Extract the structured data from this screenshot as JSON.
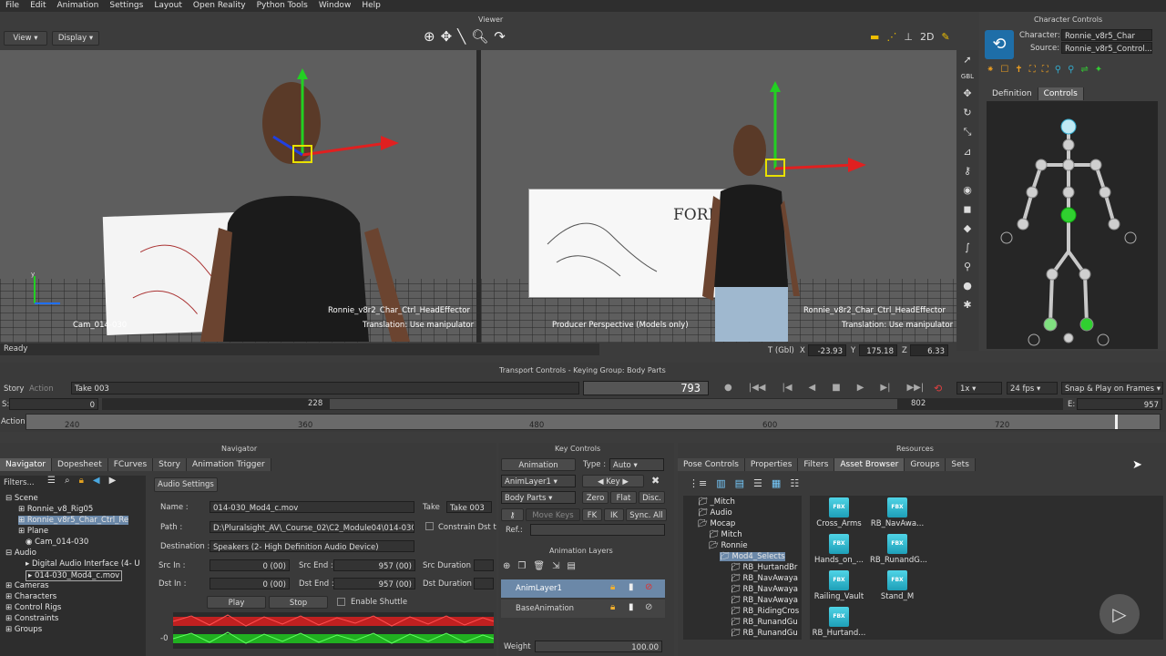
{
  "menu": [
    "File",
    "Edit",
    "Animation",
    "Settings",
    "Layout",
    "Open Reality",
    "Python Tools",
    "Window",
    "Help"
  ],
  "viewer": {
    "title": "Viewer",
    "view_btn": "View",
    "display_btn": "Display",
    "left_cam": "Cam_014-030",
    "left_effector": "Ronnie_v8r2_Char_Ctrl_HeadEffector",
    "left_translation": "Translation: Use manipulator",
    "right_cam": "Producer Perspective (Models only)",
    "right_effector": "Ronnie_v8r2_Char_Ctrl_HeadEffector",
    "right_translation": "Translation: Use manipulator",
    "status": "Ready",
    "coord_label": "T (Gbl)",
    "x": "-23.93",
    "y": "175.18",
    "z": "6.33",
    "board_text": "FORE"
  },
  "character_controls": {
    "title": "Character Controls",
    "character_label": "Character:",
    "character_value": "Ronnie_v8r5_Char",
    "source_label": "Source:",
    "source_value": "Ronnie_v8r5_Control...",
    "tab_definition": "Definition",
    "tab_controls": "Controls"
  },
  "transport": {
    "title": "Transport Controls  -  Keying Group: Body Parts",
    "story": "Story",
    "action": "Action",
    "take": "Take 003",
    "frame": "793",
    "speed": "1x",
    "fps": "24 fps",
    "snap": "Snap & Play on Frames",
    "s_label": "S:",
    "s_val": "0",
    "slider_left": "228",
    "slider_right": "802",
    "e_label": "E:",
    "e_val": "957",
    "action_label": "Action",
    "ticks": [
      "240",
      "360",
      "480",
      "600",
      "720"
    ]
  },
  "navigator": {
    "title": "Navigator",
    "tabs": [
      "Navigator",
      "Dopesheet",
      "FCurves",
      "Story",
      "Animation Trigger"
    ],
    "filters": "Filters...",
    "tree": [
      "Scene",
      "Ronnie_v8_Rig05",
      "Ronnie_v8r5_Char_Ctrl_Re",
      "Plane",
      "Cam_014-030",
      "Audio",
      "Digital Audio Interface (4- U",
      "014-030_Mod4_c.mov",
      "Cameras",
      "Characters",
      "Control Rigs",
      "Constraints",
      "Groups"
    ],
    "audio_settings": "Audio Settings",
    "name_label": "Name :",
    "name_value": "014-030_Mod4_c.mov",
    "take_label": "Take",
    "take_value": "Take 003",
    "path_label": "Path :",
    "path_value": "D:\\Pluralsight_AV\\_Course_02\\C2_Module04\\014-030_Mo",
    "constrain": "Constrain Dst t",
    "dest_label": "Destination :",
    "dest_value": "Speakers (2- High Definition Audio Device)",
    "srcin_label": "Src In :",
    "srcin_val": "0 (00)",
    "srcend_label": "Src End :",
    "srcend_val": "957 (00)",
    "srcdur_label": "Src Duration :",
    "dstin_label": "Dst In :",
    "dstin_val": "0 (00)",
    "dstend_label": "Dst End :",
    "dstend_val": "957 (00)",
    "dstdur_label": "Dst Duration :",
    "play": "Play",
    "stop": "Stop",
    "shuttle": "Enable Shuttle",
    "wave_label": "-0"
  },
  "key_controls": {
    "title": "Key Controls",
    "animation": "Animation",
    "type_label": "Type :",
    "type_value": "Auto",
    "layer": "AnimLayer1",
    "key": "Key",
    "body_parts": "Body Parts",
    "zero": "Zero",
    "flat": "Flat",
    "disc": "Disc.",
    "move_keys": "Move Keys",
    "fk": "FK",
    "ik": "IK",
    "sync": "Sync. All",
    "ref": "Ref.:",
    "layers_title": "Animation Layers",
    "layer1": "AnimLayer1",
    "base": "BaseAnimation",
    "weight": "Weight",
    "weight_val": "100.00"
  },
  "resources": {
    "title": "Resources",
    "tabs": [
      "Pose Controls",
      "Properties",
      "Filters",
      "Asset Browser",
      "Groups",
      "Sets"
    ],
    "tree": [
      "_Mitch",
      "Audio",
      "Mocap",
      "Mitch",
      "Ronnie",
      "Mod4_Selects",
      "RB_HurtandBr",
      "RB_NavAwaya",
      "RB_NavAwaya",
      "RB_NavAwaya",
      "RB_RidingCros",
      "RB_RunandGu",
      "RB_RunandGu"
    ],
    "assets": [
      "Cross_Arms",
      "RB_NavAwa...",
      "Hands_on_...",
      "RB_RunandG...",
      "Railing_Vault",
      "Stand_M",
      "RB_Hurtand..."
    ]
  }
}
